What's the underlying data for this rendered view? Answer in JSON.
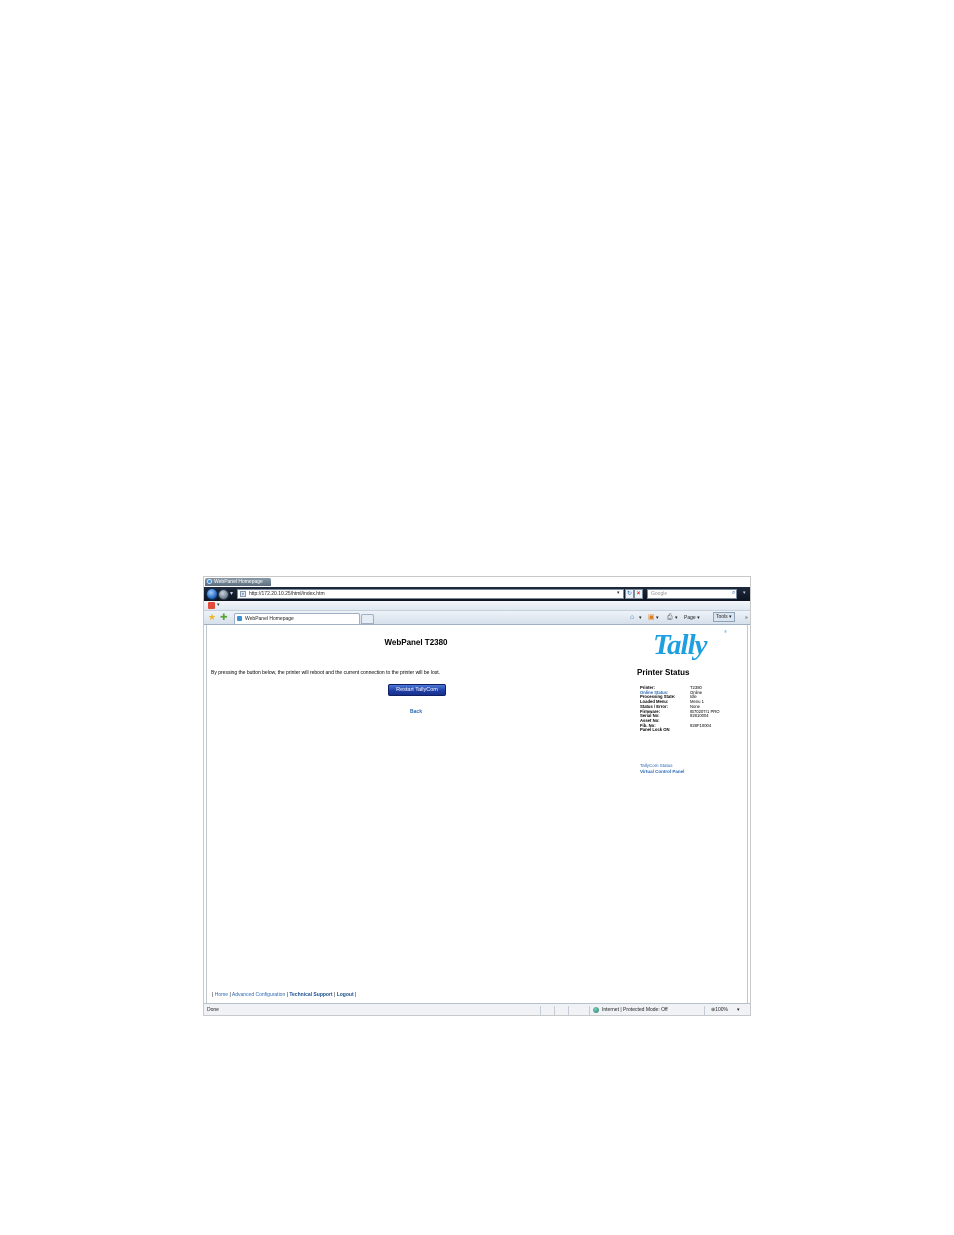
{
  "browser": {
    "window_title": "WebPanel Homepage",
    "address": "http://172.20.10.25/html/index.htm",
    "search_placeholder": "Google",
    "tab_title": "WebPanel Homepage",
    "commands": {
      "page": "Page ▾",
      "tools": "Tools ▾",
      "more": "»"
    },
    "status_text": "Done",
    "zone": "Internet | Protected Mode: Off",
    "zoom": "100%"
  },
  "page": {
    "title": "WebPanel T2380",
    "intro": "By pressing the button below, the printer will reboot and the current connection to the printer will be lost.",
    "restart_label": "Restart TallyCom",
    "back_label": "Back",
    "logo": "Tally",
    "logo_mark": "®",
    "status_heading": "Printer Status",
    "status_rows": [
      {
        "label": "Printer:",
        "value": "T2380"
      },
      {
        "label": "Online Status:",
        "value": "Online"
      },
      {
        "label": "Processing State:",
        "value": "Idle"
      },
      {
        "label": "Loaded Menu:",
        "value": "Menu 1"
      },
      {
        "label": "Status / Error:",
        "value": "None"
      },
      {
        "label": "Firmware:",
        "value": "IB70207r1 PRO"
      },
      {
        "label": "Serial No:",
        "value": "92810004"
      },
      {
        "label": "Asset No:",
        "value": ""
      },
      {
        "label": "Fib. No:",
        "value": "928F10004"
      },
      {
        "label": "Panel Lock ON",
        "value": ""
      }
    ],
    "side_links": {
      "tallycom_status": "TallyCom Status",
      "virtual_panel": "Virtual Control Panel"
    },
    "footer": {
      "sep": "|",
      "home": "Home",
      "advanced": "Advanced Configuration",
      "support": "Technical Support",
      "logout": "Logout"
    }
  }
}
